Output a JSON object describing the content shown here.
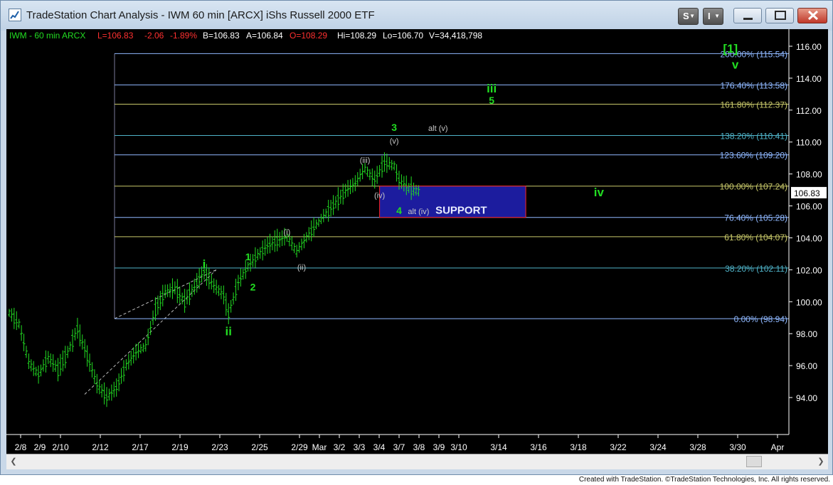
{
  "window": {
    "title": "TradeStation Chart Analysis - IWM 60 min [ARCX] iShs Russell 2000 ETF",
    "s_button": "S",
    "i_button": "I"
  },
  "header": {
    "symbol": "IWM - 60 min  ARCX",
    "low": "L=106.83",
    "change": "-2.06",
    "change_pct": "-1.89%",
    "bid": "B=106.83",
    "ask": "A=106.84",
    "open": "O=108.29",
    "high": "Hi=108.29",
    "lo": "Lo=106.70",
    "volume": "V=34,418,798"
  },
  "colors": {
    "green": "#22dd22",
    "red": "#ff3030",
    "price_white": "#ffffff",
    "support_fill": "#1c1c9e",
    "support_border": "#ff2222",
    "fib_blue": "#8fb8ff",
    "fib_olive": "#c8c86a",
    "fib_cyan": "#4fb3c8",
    "axis_text": "#ffffff"
  },
  "price_axis": {
    "ticks": [
      "116.00",
      "114.00",
      "112.00",
      "110.00",
      "108.00",
      "106.00",
      "104.00",
      "102.00",
      "100.00",
      "98.00",
      "96.00",
      "94.00"
    ],
    "last_price": "106.83"
  },
  "date_axis": {
    "labels": [
      "2/8",
      "2/9",
      "2/10",
      "2/12",
      "2/17",
      "2/19",
      "2/23",
      "2/25",
      "2/29",
      "Mar",
      "3/2",
      "3/3",
      "3/4",
      "3/7",
      "3/8",
      "3/9",
      "3/10",
      "3/14",
      "3/16",
      "3/18",
      "3/22",
      "3/24",
      "3/28",
      "3/30",
      "Apr"
    ]
  },
  "fib_levels": [
    {
      "label": "200.00% (115.54)",
      "price": 115.54,
      "color": "blue"
    },
    {
      "label": "176.40% (113.58)",
      "price": 113.58,
      "color": "blue"
    },
    {
      "label": "161.80% (112.37)",
      "price": 112.37,
      "color": "olive"
    },
    {
      "label": "138.20% (110.41)",
      "price": 110.41,
      "color": "cyan"
    },
    {
      "label": "123.60% (109.20)",
      "price": 109.2,
      "color": "blue"
    },
    {
      "label": "100.00% (107.24)",
      "price": 107.24,
      "color": "olive"
    },
    {
      "label": "76.40% (105.28)",
      "price": 105.28,
      "color": "blue"
    },
    {
      "label": "61.80% (104.07)",
      "price": 104.07,
      "color": "olive"
    },
    {
      "label": "38.20% (102.11)",
      "price": 102.11,
      "color": "cyan"
    },
    {
      "label": "0.00% (98.94)",
      "price": 98.94,
      "color": "blue"
    }
  ],
  "wave_labels": [
    {
      "text": "[1]",
      "bar": 148,
      "price": 115.6,
      "style": "green-large"
    },
    {
      "text": "v",
      "bar": 149,
      "price": 114.6,
      "style": "green-large"
    },
    {
      "text": "iii",
      "bar": 99,
      "price": 113.1,
      "style": "green-large"
    },
    {
      "text": "5",
      "bar": 99,
      "price": 112.4,
      "style": "green"
    },
    {
      "text": "3",
      "bar": 79,
      "price": 110.7,
      "style": "green"
    },
    {
      "text": "alt (v)",
      "bar": 88,
      "price": 110.7,
      "style": "grey"
    },
    {
      "text": "(v)",
      "bar": 79,
      "price": 109.9,
      "style": "grey"
    },
    {
      "text": "(iii)",
      "bar": 73,
      "price": 108.7,
      "style": "grey"
    },
    {
      "text": "(iv)",
      "bar": 76,
      "price": 106.5,
      "style": "grey"
    },
    {
      "text": "4",
      "bar": 80,
      "price": 105.5,
      "style": "green"
    },
    {
      "text": "alt (iv)",
      "bar": 84,
      "price": 105.5,
      "style": "grey"
    },
    {
      "text": "iv",
      "bar": 121,
      "price": 106.6,
      "style": "green-large"
    },
    {
      "text": "(i)",
      "bar": 57,
      "price": 104.2,
      "style": "grey"
    },
    {
      "text": "(ii)",
      "bar": 60,
      "price": 102.0,
      "style": "grey"
    },
    {
      "text": "1",
      "bar": 49,
      "price": 102.6,
      "style": "green"
    },
    {
      "text": "2",
      "bar": 50,
      "price": 100.7,
      "style": "green"
    },
    {
      "text": "i",
      "bar": 40,
      "price": 102.1,
      "style": "green-large"
    },
    {
      "text": "ii",
      "bar": 45,
      "price": 97.9,
      "style": "green-large"
    }
  ],
  "support_box": {
    "label": "SUPPORT",
    "top_price": 107.24,
    "bottom_price": 105.28,
    "start_bar": 76,
    "end_bar": 106
  },
  "footer": {
    "credit": "Created with TradeStation. ©TradeStation Technologies, Inc. All rights reserved."
  },
  "chart_data": {
    "type": "bar",
    "title": "",
    "ylim": [
      92,
      117
    ],
    "price_path": [
      [
        0,
        99.3
      ],
      [
        2,
        98.6
      ],
      [
        4,
        96.2
      ],
      [
        6,
        95.4
      ],
      [
        8,
        96.5
      ],
      [
        10,
        95.7
      ],
      [
        12,
        96.8
      ],
      [
        14,
        98.3
      ],
      [
        16,
        96.6
      ],
      [
        18,
        94.8
      ],
      [
        20,
        94.0
      ],
      [
        22,
        94.6
      ],
      [
        24,
        96.0
      ],
      [
        26,
        96.8
      ],
      [
        28,
        97.2
      ],
      [
        30,
        99.5
      ],
      [
        32,
        100.6
      ],
      [
        34,
        100.8
      ],
      [
        36,
        100.0
      ],
      [
        38,
        100.9
      ],
      [
        40,
        101.9
      ],
      [
        42,
        101.0
      ],
      [
        44,
        100.4
      ],
      [
        45,
        99.2
      ],
      [
        47,
        101.2
      ],
      [
        49,
        102.2
      ],
      [
        51,
        102.9
      ],
      [
        53,
        103.5
      ],
      [
        55,
        103.8
      ],
      [
        57,
        104.1
      ],
      [
        59,
        103.1
      ],
      [
        61,
        104.0
      ],
      [
        63,
        104.8
      ],
      [
        65,
        105.5
      ],
      [
        67,
        106.2
      ],
      [
        69,
        106.9
      ],
      [
        71,
        107.4
      ],
      [
        73,
        108.3
      ],
      [
        75,
        107.6
      ],
      [
        77,
        108.7
      ],
      [
        79,
        108.5
      ],
      [
        80,
        107.6
      ],
      [
        82,
        107.1
      ],
      [
        84,
        106.9
      ]
    ]
  }
}
